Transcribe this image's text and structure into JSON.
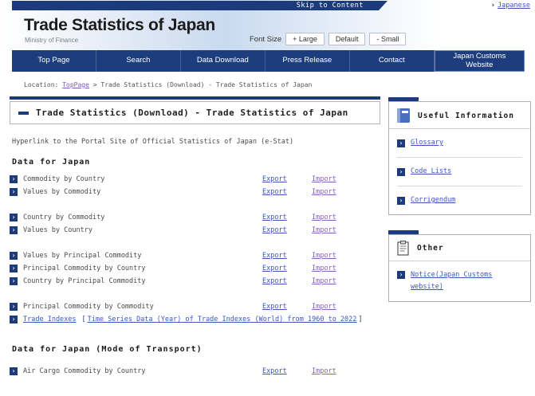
{
  "header": {
    "skip_link": "Skip to Content",
    "japanese_link": "Japanese",
    "site_title": "Trade Statistics of Japan",
    "site_subtitle": "Ministry of Finance",
    "font_size": {
      "label": "Font Size",
      "large": "+ Large",
      "default": "Default",
      "small": "- Small"
    }
  },
  "nav": {
    "items": [
      "Top Page",
      "Search",
      "Data Download",
      "Press Release",
      "Contact",
      "Japan Customs Website"
    ]
  },
  "breadcrumb": {
    "label": "Location:",
    "top_page": "TopPage",
    "separator": ">",
    "current": "Trade Statistics (Download) - Trade Statistics of Japan"
  },
  "main": {
    "page_title": "Trade Statistics (Download) - Trade Statistics of Japan",
    "intro": "Hyperlink to the Portal Site of Official Statistics of Japan (e-Stat)",
    "section1_heading": "Data for Japan",
    "labels": {
      "export": "Export",
      "import": "Import"
    },
    "groups": [
      {
        "items": [
          {
            "label": "Commodity by Country"
          },
          {
            "label": "Values by Commodity"
          }
        ]
      },
      {
        "items": [
          {
            "label": "Country by Commodity"
          },
          {
            "label": "Values by Country"
          }
        ]
      },
      {
        "items": [
          {
            "label": "Values by Principal Commodity"
          },
          {
            "label": "Principal Commodity by Country"
          },
          {
            "label": "Country by Principal Commodity"
          }
        ]
      },
      {
        "items": [
          {
            "label": "Principal Commodity by Commodity"
          }
        ]
      }
    ],
    "trade_indexes": {
      "link": "Trade Indexes",
      "bracket_open": "[",
      "bracket_link": "Time Series Data (Year) of Trade Indexes (World) from 1960 to 2022",
      "bracket_close": "]"
    },
    "section2_heading": "Data for Japan (Mode of Transport)",
    "air_cargo": {
      "label": "Air Cargo Commodity by Country"
    }
  },
  "sidebar": {
    "useful_information": {
      "title": "Useful Information",
      "links": [
        {
          "label": "Glossary"
        },
        {
          "label": "Code Lists"
        },
        {
          "label": "Corrigendum"
        }
      ]
    },
    "other": {
      "title": "Other",
      "links": [
        {
          "label": "Notice(Japan Customs website)"
        }
      ]
    }
  },
  "colors": {
    "navy": "#1b3b7c",
    "link_blue": "#3d56c0",
    "visited_purple": "#8a63b8"
  }
}
